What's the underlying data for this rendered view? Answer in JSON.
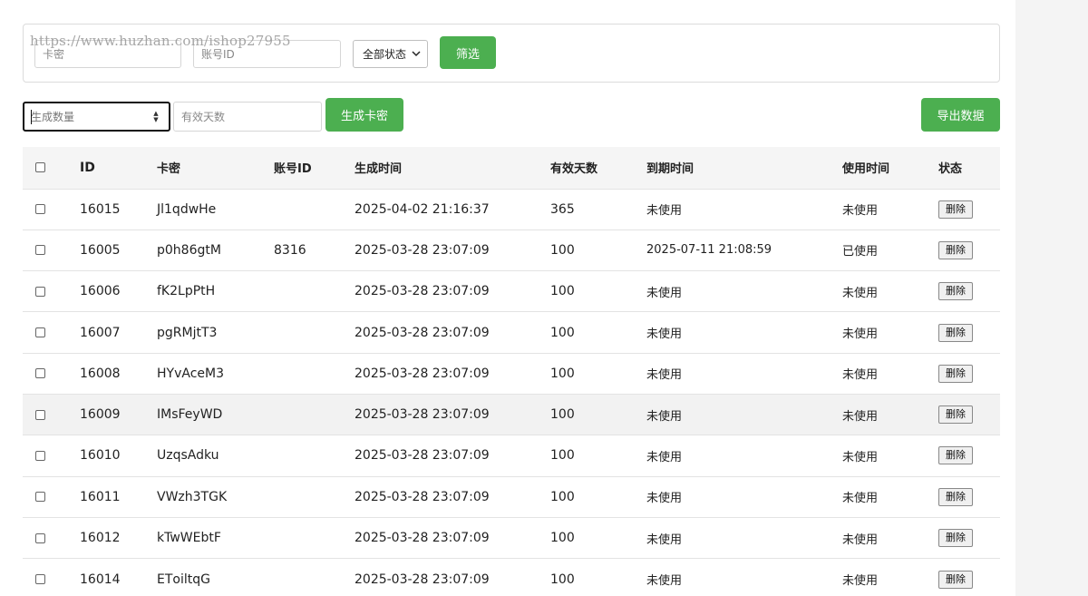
{
  "watermark": "https://www.huzhan.com/ishop27955",
  "filter": {
    "card_placeholder": "卡密",
    "account_placeholder": "账号ID",
    "status_selected": "全部状态",
    "filter_button": "筛选"
  },
  "generate": {
    "qty_placeholder": "生成数量",
    "days_placeholder": "有效天数",
    "generate_button": "生成卡密",
    "export_button": "导出数据"
  },
  "table": {
    "headers": [
      "ID",
      "卡密",
      "账号ID",
      "生成时间",
      "有效天数",
      "到期时间",
      "使用时间",
      "状态"
    ],
    "delete_label": "删除",
    "rows": [
      {
        "id": "16015",
        "card": "Jl1qdwHe",
        "account": "",
        "created": "2025-04-02 21:16:37",
        "days": "365",
        "expire": "未使用",
        "used": "未使用"
      },
      {
        "id": "16005",
        "card": "p0h86gtM",
        "account": "8316",
        "created": "2025-03-28 23:07:09",
        "days": "100",
        "expire": "2025-07-11 21:08:59",
        "used": "已使用"
      },
      {
        "id": "16006",
        "card": "fK2LpPtH",
        "account": "",
        "created": "2025-03-28 23:07:09",
        "days": "100",
        "expire": "未使用",
        "used": "未使用"
      },
      {
        "id": "16007",
        "card": "pgRMjtT3",
        "account": "",
        "created": "2025-03-28 23:07:09",
        "days": "100",
        "expire": "未使用",
        "used": "未使用"
      },
      {
        "id": "16008",
        "card": "HYvAceM3",
        "account": "",
        "created": "2025-03-28 23:07:09",
        "days": "100",
        "expire": "未使用",
        "used": "未使用"
      },
      {
        "id": "16009",
        "card": "IMsFeyWD",
        "account": "",
        "created": "2025-03-28 23:07:09",
        "days": "100",
        "expire": "未使用",
        "used": "未使用"
      },
      {
        "id": "16010",
        "card": "UzqsAdku",
        "account": "",
        "created": "2025-03-28 23:07:09",
        "days": "100",
        "expire": "未使用",
        "used": "未使用"
      },
      {
        "id": "16011",
        "card": "VWzh3TGK",
        "account": "",
        "created": "2025-03-28 23:07:09",
        "days": "100",
        "expire": "未使用",
        "used": "未使用"
      },
      {
        "id": "16012",
        "card": "kTwWEbtF",
        "account": "",
        "created": "2025-03-28 23:07:09",
        "days": "100",
        "expire": "未使用",
        "used": "未使用"
      },
      {
        "id": "16014",
        "card": "ETоiltqG",
        "account": "",
        "created": "2025-03-28 23:07:09",
        "days": "100",
        "expire": "未使用",
        "used": "未使用"
      }
    ]
  },
  "colors": {
    "accent": "#4caf50",
    "header_bg": "#f5f5f5",
    "hover_row": "#f2f2f2"
  },
  "icons": {
    "select_chevron": "chevron-down-icon",
    "spinner": "spinner-arrows-icon"
  }
}
